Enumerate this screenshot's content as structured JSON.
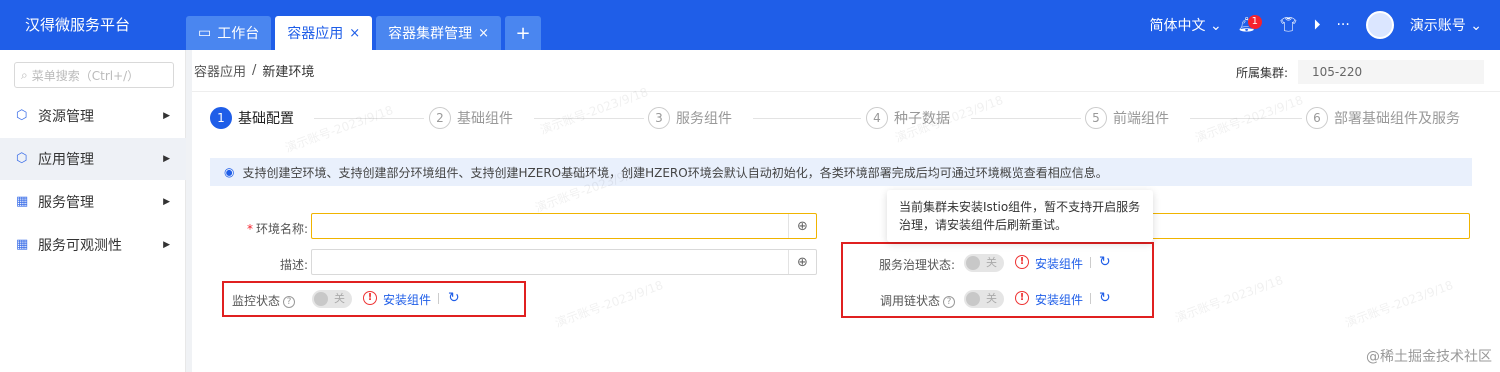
{
  "app": {
    "title": "汉得微服务平台"
  },
  "tabs": [
    {
      "label": "工作台",
      "closable": false
    },
    {
      "label": "容器应用",
      "closable": true,
      "active": true
    },
    {
      "label": "容器集群管理",
      "closable": true
    }
  ],
  "tab_add": "+",
  "tab_close": "×",
  "topbar": {
    "language": "简体中文",
    "notifications": "1",
    "more": "···",
    "account": "演示账号"
  },
  "sidebar": {
    "search_placeholder": "菜单搜索（Ctrl+/）",
    "items": [
      {
        "label": "资源管理",
        "icon": "cube-icon"
      },
      {
        "label": "应用管理",
        "icon": "cube-icon",
        "active": true
      },
      {
        "label": "服务管理",
        "icon": "grid-icon"
      },
      {
        "label": "服务可观测性",
        "icon": "grid-icon"
      }
    ]
  },
  "breadcrumb": {
    "parent": "容器应用",
    "separator": "/",
    "current": "新建环境"
  },
  "cluster": {
    "label": "所属集群:",
    "value": "105-220"
  },
  "steps": [
    {
      "num": "1",
      "label": "基础配置",
      "active": true
    },
    {
      "num": "2",
      "label": "基础组件"
    },
    {
      "num": "3",
      "label": "服务组件"
    },
    {
      "num": "4",
      "label": "种子数据"
    },
    {
      "num": "5",
      "label": "前端组件"
    },
    {
      "num": "6",
      "label": "部署基础组件及服务"
    }
  ],
  "info": "支持创建空环境、支持创建部分环境组件、支持创建HZERO基础环境，创建HZERO环境会默认自动初始化，各类环境部署完成后均可通过环境概览查看相应信息。",
  "form": {
    "env_name_label": "环境名称:",
    "desc_label": "描述:",
    "monitor_label": "监控状态",
    "service_gov_label": "服务治理状态:",
    "trace_label": "调用链状态",
    "switch_off": "关",
    "install_link": "安装组件"
  },
  "tooltip": "当前集群未安装Istio组件，暂不支持开启服务治理，请安装组件后刷新重试。",
  "watermark": "演示账号-2023/9/18",
  "footer_watermark": "@稀土掘金技术社区",
  "colors": {
    "primary": "#1f5ee8",
    "highlight_box": "#e02020",
    "warning": "#ee3333"
  }
}
